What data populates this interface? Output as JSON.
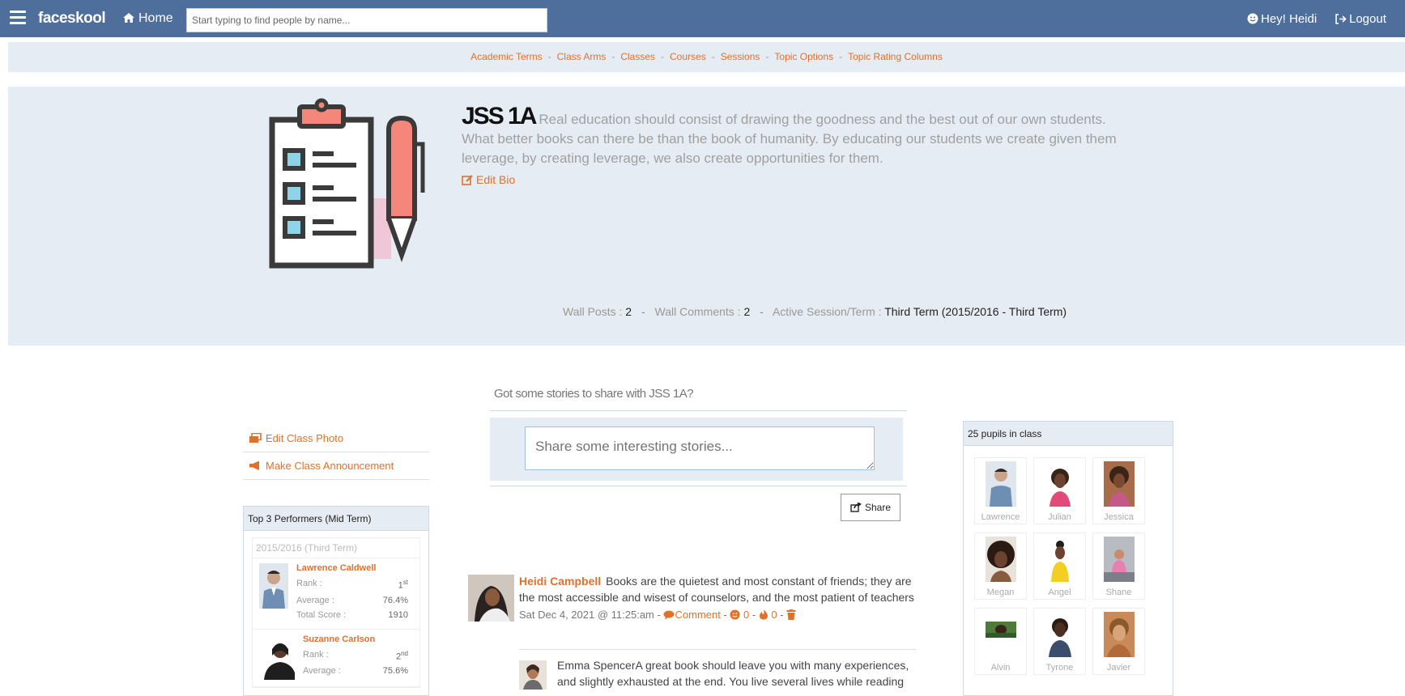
{
  "navbar": {
    "brand": "faceskool",
    "home_label": "Home",
    "search_placeholder": "Start typing to find people by name...",
    "greeting": "Hey! Heidi",
    "logout_label": "Logout"
  },
  "subnav": {
    "items": [
      "Academic Terms",
      "Class Arms",
      "Classes",
      "Courses",
      "Sessions",
      "Topic Options",
      "Topic Rating Columns"
    ],
    "separator": "-"
  },
  "hero": {
    "class_name": "JSS 1A",
    "bio": "Real education should consist of drawing the goodness and the best out of our own students. What better books can there be than the book of humanity. By educating our students we create given them leverage, by creating leverage, we also create opportunities for them.",
    "edit_bio_label": "Edit Bio",
    "stats": {
      "wall_posts_label": "Wall Posts :",
      "wall_posts": "2",
      "wall_comments_label": "Wall Comments :",
      "wall_comments": "2",
      "active_session_label": "Active Session/Term :",
      "active_session": "Third Term (2015/2016 - Third Term)",
      "separator": "-"
    }
  },
  "left": {
    "edit_photo_label": "Edit Class Photo",
    "announcement_label": "Make Class Announcement",
    "top_performers": {
      "title": "Top 3 Performers (Mid Term)",
      "term": "2015/2016 (Third Term)",
      "rank_label": "Rank :",
      "average_label": "Average :",
      "total_label": "Total Score :",
      "items": [
        {
          "name": "Lawrence Caldwell",
          "rank": "1",
          "rank_suffix": "st",
          "average": "76.4%",
          "total": "1910"
        },
        {
          "name": "Suzanne Carlson",
          "rank": "2",
          "rank_suffix": "nd",
          "average": "75.6%",
          "total": ""
        }
      ]
    }
  },
  "wall": {
    "prompt": "Got some stories to share with JSS 1A?",
    "input_placeholder": "Share some interesting stories...",
    "share_label": "Share",
    "post": {
      "author": "Heidi Campbell",
      "text": "Books are the quietest and most constant of friends; they are the most accessible and wisest of counselors, and the most patient of teachers",
      "date": "Sat Dec 4, 2021 @ 11:25:am -",
      "comment_label": "Comment",
      "likes": "0",
      "dislikes": "0"
    },
    "comment": {
      "author": "Emma Spencer",
      "text": "A great book should leave you with many experiences, and slightly exhausted at the end. You live several lives while reading"
    }
  },
  "pupils": {
    "title": "25 pupils in class",
    "names": [
      "Lawrence",
      "Julian",
      "Jessica",
      "Megan",
      "Angel",
      "Shane",
      "Alvin",
      "Tyrone",
      "Javier"
    ]
  },
  "colors": {
    "navbar": "#4e6e9b",
    "accent": "#e0712b",
    "panel_bg": "#e6ecf4"
  }
}
